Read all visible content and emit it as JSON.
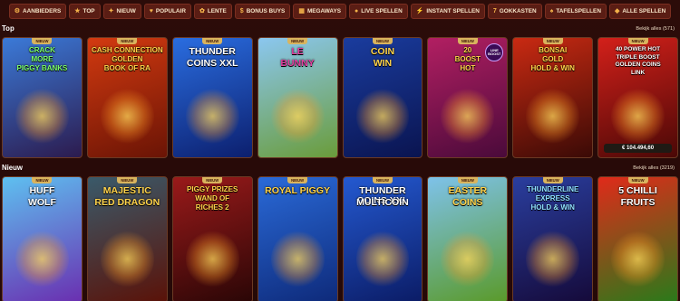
{
  "filters": [
    {
      "label": "AANBIEDERS",
      "icon": "⚙"
    },
    {
      "label": "TOP",
      "icon": "★"
    },
    {
      "label": "NIEUW",
      "icon": "✦"
    },
    {
      "label": "POPULAIR",
      "icon": "♥"
    },
    {
      "label": "LENTE",
      "icon": "✿"
    },
    {
      "label": "BONUS BUYS",
      "icon": "$"
    },
    {
      "label": "MEGAWAYS",
      "icon": "▦"
    },
    {
      "label": "LIVE SPELLEN",
      "icon": "●"
    },
    {
      "label": "INSTANT SPELLEN",
      "icon": "⚡"
    },
    {
      "label": "GOKKASTEN",
      "icon": "7"
    },
    {
      "label": "TAFELSPELLEN",
      "icon": "♠"
    },
    {
      "label": "ALLE SPELLEN",
      "icon": "◆"
    }
  ],
  "sections": {
    "top": {
      "title": "Top",
      "view_all": "Bekijk alles (571)"
    },
    "new": {
      "title": "Nieuw",
      "view_all": "Bekijk alles (3219)"
    }
  },
  "badge_new": "NIEUW",
  "top_games": [
    {
      "name": "Crack More Piggy Banks",
      "lines": [
        "CRACK",
        "MORE",
        "PIGGY BANKS"
      ],
      "bg1": "#3b7ad8",
      "bg2": "#2c1b4e",
      "fg": "#7cff6a"
    },
    {
      "name": "Cash Connection Golden Book of Ra",
      "lines": [
        "CASH CONNECTION",
        "GOLDEN",
        "BOOK OF RA"
      ],
      "bg1": "#d33a10",
      "bg2": "#6a1405",
      "fg": "#ffd34a"
    },
    {
      "name": "Thunder Coins XXL",
      "lines": [
        "THUNDER",
        "COINS XXL"
      ],
      "bg1": "#2a6de0",
      "bg2": "#0c1f6e",
      "fg": "#ffffff"
    },
    {
      "name": "Le Bunny",
      "lines": [
        "LE",
        "BUNNY"
      ],
      "bg1": "#8bc7f0",
      "bg2": "#6a9c3a",
      "fg": "#e23fa0"
    },
    {
      "name": "Coin Win",
      "lines": [
        "COIN",
        "WIN"
      ],
      "bg1": "#1a3c9e",
      "bg2": "#0a1450",
      "fg": "#ffd34a"
    },
    {
      "name": "20 Boost Hot",
      "lines": [
        "20",
        "BOOST",
        "HOT"
      ],
      "bg1": "#b21f62",
      "bg2": "#4a0a3a",
      "fg": "#ffd34a",
      "badge": "LINE BOOST"
    },
    {
      "name": "Bonsai Gold Hold & Win",
      "lines": [
        "BONSAI",
        "GOLD",
        "HOLD & WIN"
      ],
      "bg1": "#c92a12",
      "bg2": "#3a0a06",
      "fg": "#ffd34a"
    },
    {
      "name": "40 Power Hot Triple Boost Golden Coins Link",
      "lines": [
        "40 POWER HOT",
        "TRIPLE BOOST",
        "GOLDEN COINS",
        "LINK"
      ],
      "bg1": "#d3201a",
      "bg2": "#4a0806",
      "fg": "#ffffff",
      "jackpot": "€ 104.494,60"
    }
  ],
  "new_games": [
    {
      "name": "Huff Wolf",
      "lines": [
        "HUFF",
        "WOLF"
      ],
      "bg1": "#5ec0f0",
      "bg2": "#6a2fb0",
      "fg": "#ffffff"
    },
    {
      "name": "Majestic Red Dragon",
      "lines": [
        "MAJESTIC",
        "RED DRAGON"
      ],
      "bg1": "#3a5a6a",
      "bg2": "#5a1208",
      "fg": "#ffd34a"
    },
    {
      "name": "Piggy Prizes Wand of Riches 2",
      "lines": [
        "PIGGY PRIZES",
        "WAND OF",
        "RICHES 2"
      ],
      "bg1": "#9a1a1a",
      "bg2": "#2a0606",
      "fg": "#ffd34a"
    },
    {
      "name": "Royal Piggy",
      "lines": [
        "ROYAL PIGGY"
      ],
      "bg1": "#2a6ad8",
      "bg2": "#0e2a7a",
      "fg": "#ffd34a"
    },
    {
      "name": "Thunder Coins XXL Multicoin",
      "lines": [
        "THUNDER COINS XXL",
        "MULTICOIN"
      ],
      "bg1": "#2459d0",
      "bg2": "#0b1c66",
      "fg": "#ffffff"
    },
    {
      "name": "Easter Coins",
      "lines": [
        "EASTER",
        "COINS"
      ],
      "bg1": "#7ec2ea",
      "bg2": "#5a9a2a",
      "fg": "#ffd34a"
    },
    {
      "name": "Thunderline Express Hold & Win",
      "lines": [
        "THUNDERLINE",
        "EXPRESS",
        "HOLD & WIN"
      ],
      "bg1": "#2a3e9e",
      "bg2": "#150a3a",
      "fg": "#8fe0ff"
    },
    {
      "name": "5 Chilli Fruits",
      "lines": [
        "5 CHILLI",
        "FRUITS"
      ],
      "bg1": "#e02a1a",
      "bg2": "#2a7a1a",
      "fg": "#ffffff"
    }
  ]
}
